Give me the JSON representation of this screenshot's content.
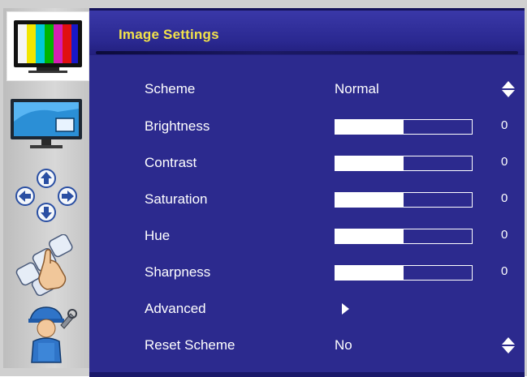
{
  "panel": {
    "title": "Image Settings",
    "accent_color": "#f2e24a",
    "background_color": "#2c2a8e"
  },
  "sidebar": {
    "items": [
      {
        "name": "image-settings",
        "icon": "tv-color-bars-icon",
        "active": true
      },
      {
        "name": "display",
        "icon": "monitor-icon",
        "active": false
      },
      {
        "name": "position",
        "icon": "arrows-icon",
        "active": false
      },
      {
        "name": "osd-keys",
        "icon": "hand-keys-icon",
        "active": false
      },
      {
        "name": "service",
        "icon": "technician-icon",
        "active": false
      }
    ]
  },
  "settings": {
    "scheme": {
      "label": "Scheme",
      "value": "Normal",
      "icon": "up-down-icon"
    },
    "brightness": {
      "label": "Brightness",
      "value": "0",
      "level": 0.5
    },
    "contrast": {
      "label": "Contrast",
      "value": "0",
      "level": 0.5
    },
    "saturation": {
      "label": "Saturation",
      "value": "0",
      "level": 0.5
    },
    "hue": {
      "label": "Hue",
      "value": "0",
      "level": 0.5
    },
    "sharpness": {
      "label": "Sharpness",
      "value": "0",
      "level": 0.5
    },
    "advanced": {
      "label": "Advanced",
      "icon": "arrow-right-icon"
    },
    "reset_scheme": {
      "label": "Reset Scheme",
      "value": "No",
      "icon": "up-down-icon"
    }
  }
}
